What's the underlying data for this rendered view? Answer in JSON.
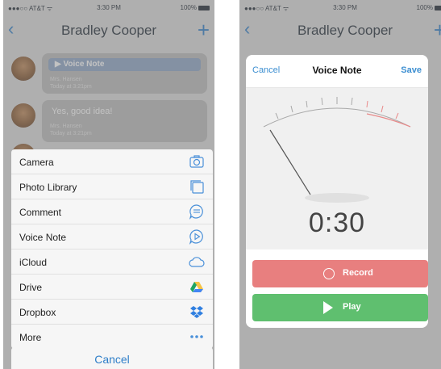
{
  "status_bar": {
    "carrier": "●●●○○ AT&T ᯤ",
    "time": "3:30 PM",
    "battery": "100%"
  },
  "nav": {
    "back": "‹",
    "title": "Bradley Cooper",
    "add": "+"
  },
  "chat": {
    "messages": [
      {
        "type": "voice",
        "label": "▶ Voice Note",
        "author": "Mrs. Hansen",
        "time": "Today at 3:21pm"
      },
      {
        "type": "text",
        "text": "Yes, good idea!",
        "author": "Mrs. Hansen",
        "time": "Today at 3:21pm"
      }
    ]
  },
  "action_sheet": {
    "items": [
      {
        "label": "Camera",
        "icon": "camera-icon"
      },
      {
        "label": "Photo Library",
        "icon": "photo-library-icon"
      },
      {
        "label": "Comment",
        "icon": "comment-icon"
      },
      {
        "label": "Voice Note",
        "icon": "voice-note-icon"
      },
      {
        "label": "iCloud",
        "icon": "icloud-icon"
      },
      {
        "label": "Drive",
        "icon": "drive-icon"
      },
      {
        "label": "Dropbox",
        "icon": "dropbox-icon"
      },
      {
        "label": "More",
        "icon": "more-icon"
      }
    ],
    "cancel": "Cancel"
  },
  "voice_note": {
    "cancel": "Cancel",
    "title": "Voice Note",
    "save": "Save",
    "timer": "0:30",
    "record": "Record",
    "play": "Play"
  },
  "colors": {
    "accent": "#2f7fc9",
    "record": "#e87f7f",
    "play": "#5fbf6f",
    "sheet_icon": "#4a90d9"
  }
}
